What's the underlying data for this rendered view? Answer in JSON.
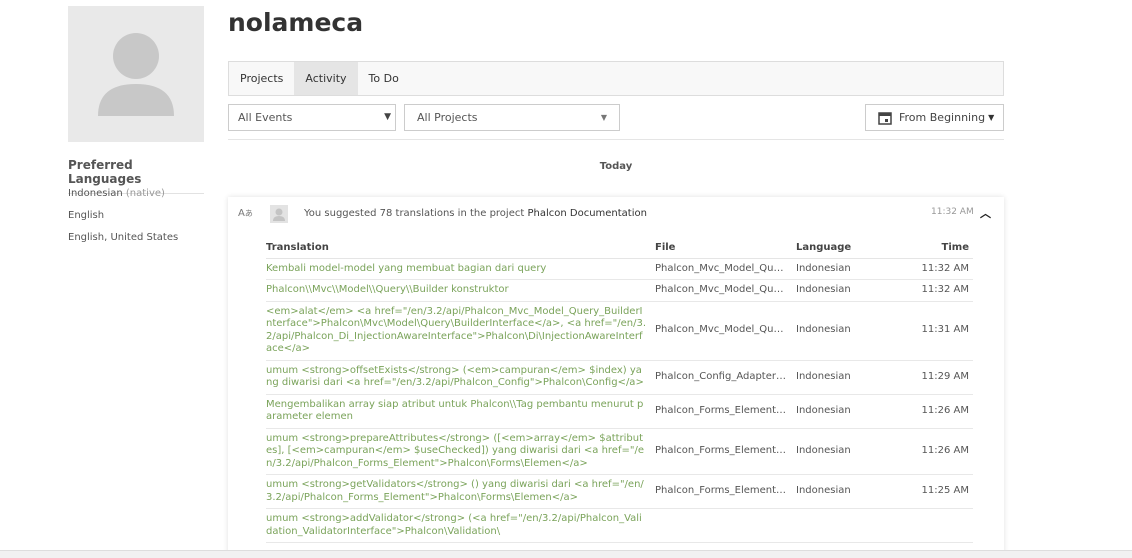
{
  "profile": {
    "username": "nolameca",
    "preferred_languages_title": "Preferred Languages",
    "languages": [
      {
        "name": "Indonesian",
        "note": "(native)"
      },
      {
        "name": "English",
        "note": ""
      },
      {
        "name": "English, United States",
        "note": ""
      }
    ]
  },
  "tabs": [
    {
      "label": "Projects",
      "active": false
    },
    {
      "label": "Activity",
      "active": true
    },
    {
      "label": "To Do",
      "active": false
    }
  ],
  "filters": {
    "events_value": "All Events",
    "projects_value": "All Projects",
    "range_label": "From Beginning"
  },
  "day_label": "Today",
  "activity": {
    "summary_prefix": "You suggested 78 translations in the project",
    "project_name": "Phalcon Documentation",
    "time": "11:32 AM",
    "columns": {
      "translation": "Translation",
      "file": "File",
      "language": "Language",
      "time": "Time"
    },
    "rows": [
      {
        "text": "Kembali model-model yang membuat bagian dari query",
        "file": "Phalcon_Mvc_Model_Query_BuilderInterface",
        "language": "Indonesian",
        "time": "11:32 AM"
      },
      {
        "text": "Phalcon\\\\Mvc\\\\Model\\\\Query\\\\Builder konstruktor",
        "file": "Phalcon_Mvc_Model_Query_Builder",
        "language": "Indonesian",
        "time": "11:32 AM"
      },
      {
        "text": "<em>alat</em> <a href=\"/en/3.2/api/Phalcon_Mvc_Model_Query_BuilderInterface\">Phalcon\\Mvc\\Model\\Query\\BuilderInterface</a>, <a href=\"/en/3.2/api/Phalcon_Di_InjectionAwareInterface\">Phalcon\\Di\\InjectionAwareInterface</a>",
        "file": "Phalcon_Mvc_Model_Query_Builder",
        "language": "Indonesian",
        "time": "11:31 AM"
      },
      {
        "text": "umum <strong>offsetExists</strong> (<em>campuran</em> $index) yang diwarisi dari <a href=\"/en/3.2/api/Phalcon_Config\">Phalcon\\Config</a>",
        "file": "Phalcon_Config_Adapter_Yaml",
        "language": "Indonesian",
        "time": "11:29 AM"
      },
      {
        "text": "Mengembalikan array siap atribut untuk Phalcon\\\\Tag pembantu menurut parameter elemen",
        "file": "Phalcon_Forms_Element_Check",
        "language": "Indonesian",
        "time": "11:26 AM"
      },
      {
        "text": "umum <strong>prepareAttributes</strong> ([<em>array</em> $attributes], [<em>campuran</em> $useChecked]) yang diwarisi dari <a href=\"/en/3.2/api/Phalcon_Forms_Element\">Phalcon\\Forms\\Elemen</a>",
        "file": "Phalcon_Forms_Element_Check",
        "language": "Indonesian",
        "time": "11:26 AM"
      },
      {
        "text": "umum <strong>getValidators</strong> () yang diwarisi dari <a href=\"/en/3.2/api/Phalcon_Forms_Element\">Phalcon\\Forms\\Elemen</a>",
        "file": "Phalcon_Forms_Element_Check",
        "language": "Indonesian",
        "time": "11:25 AM"
      },
      {
        "text": "umum <strong>addValidator</strong> (<a href=\"/en/3.2/api/Phalcon_Validation_ValidatorInterface\">Phalcon\\Validation\\",
        "file": "",
        "language": "",
        "time": ""
      }
    ]
  },
  "colors": {
    "accent_green": "#7aa35a",
    "tab_active_bg": "#e5e5e5"
  }
}
